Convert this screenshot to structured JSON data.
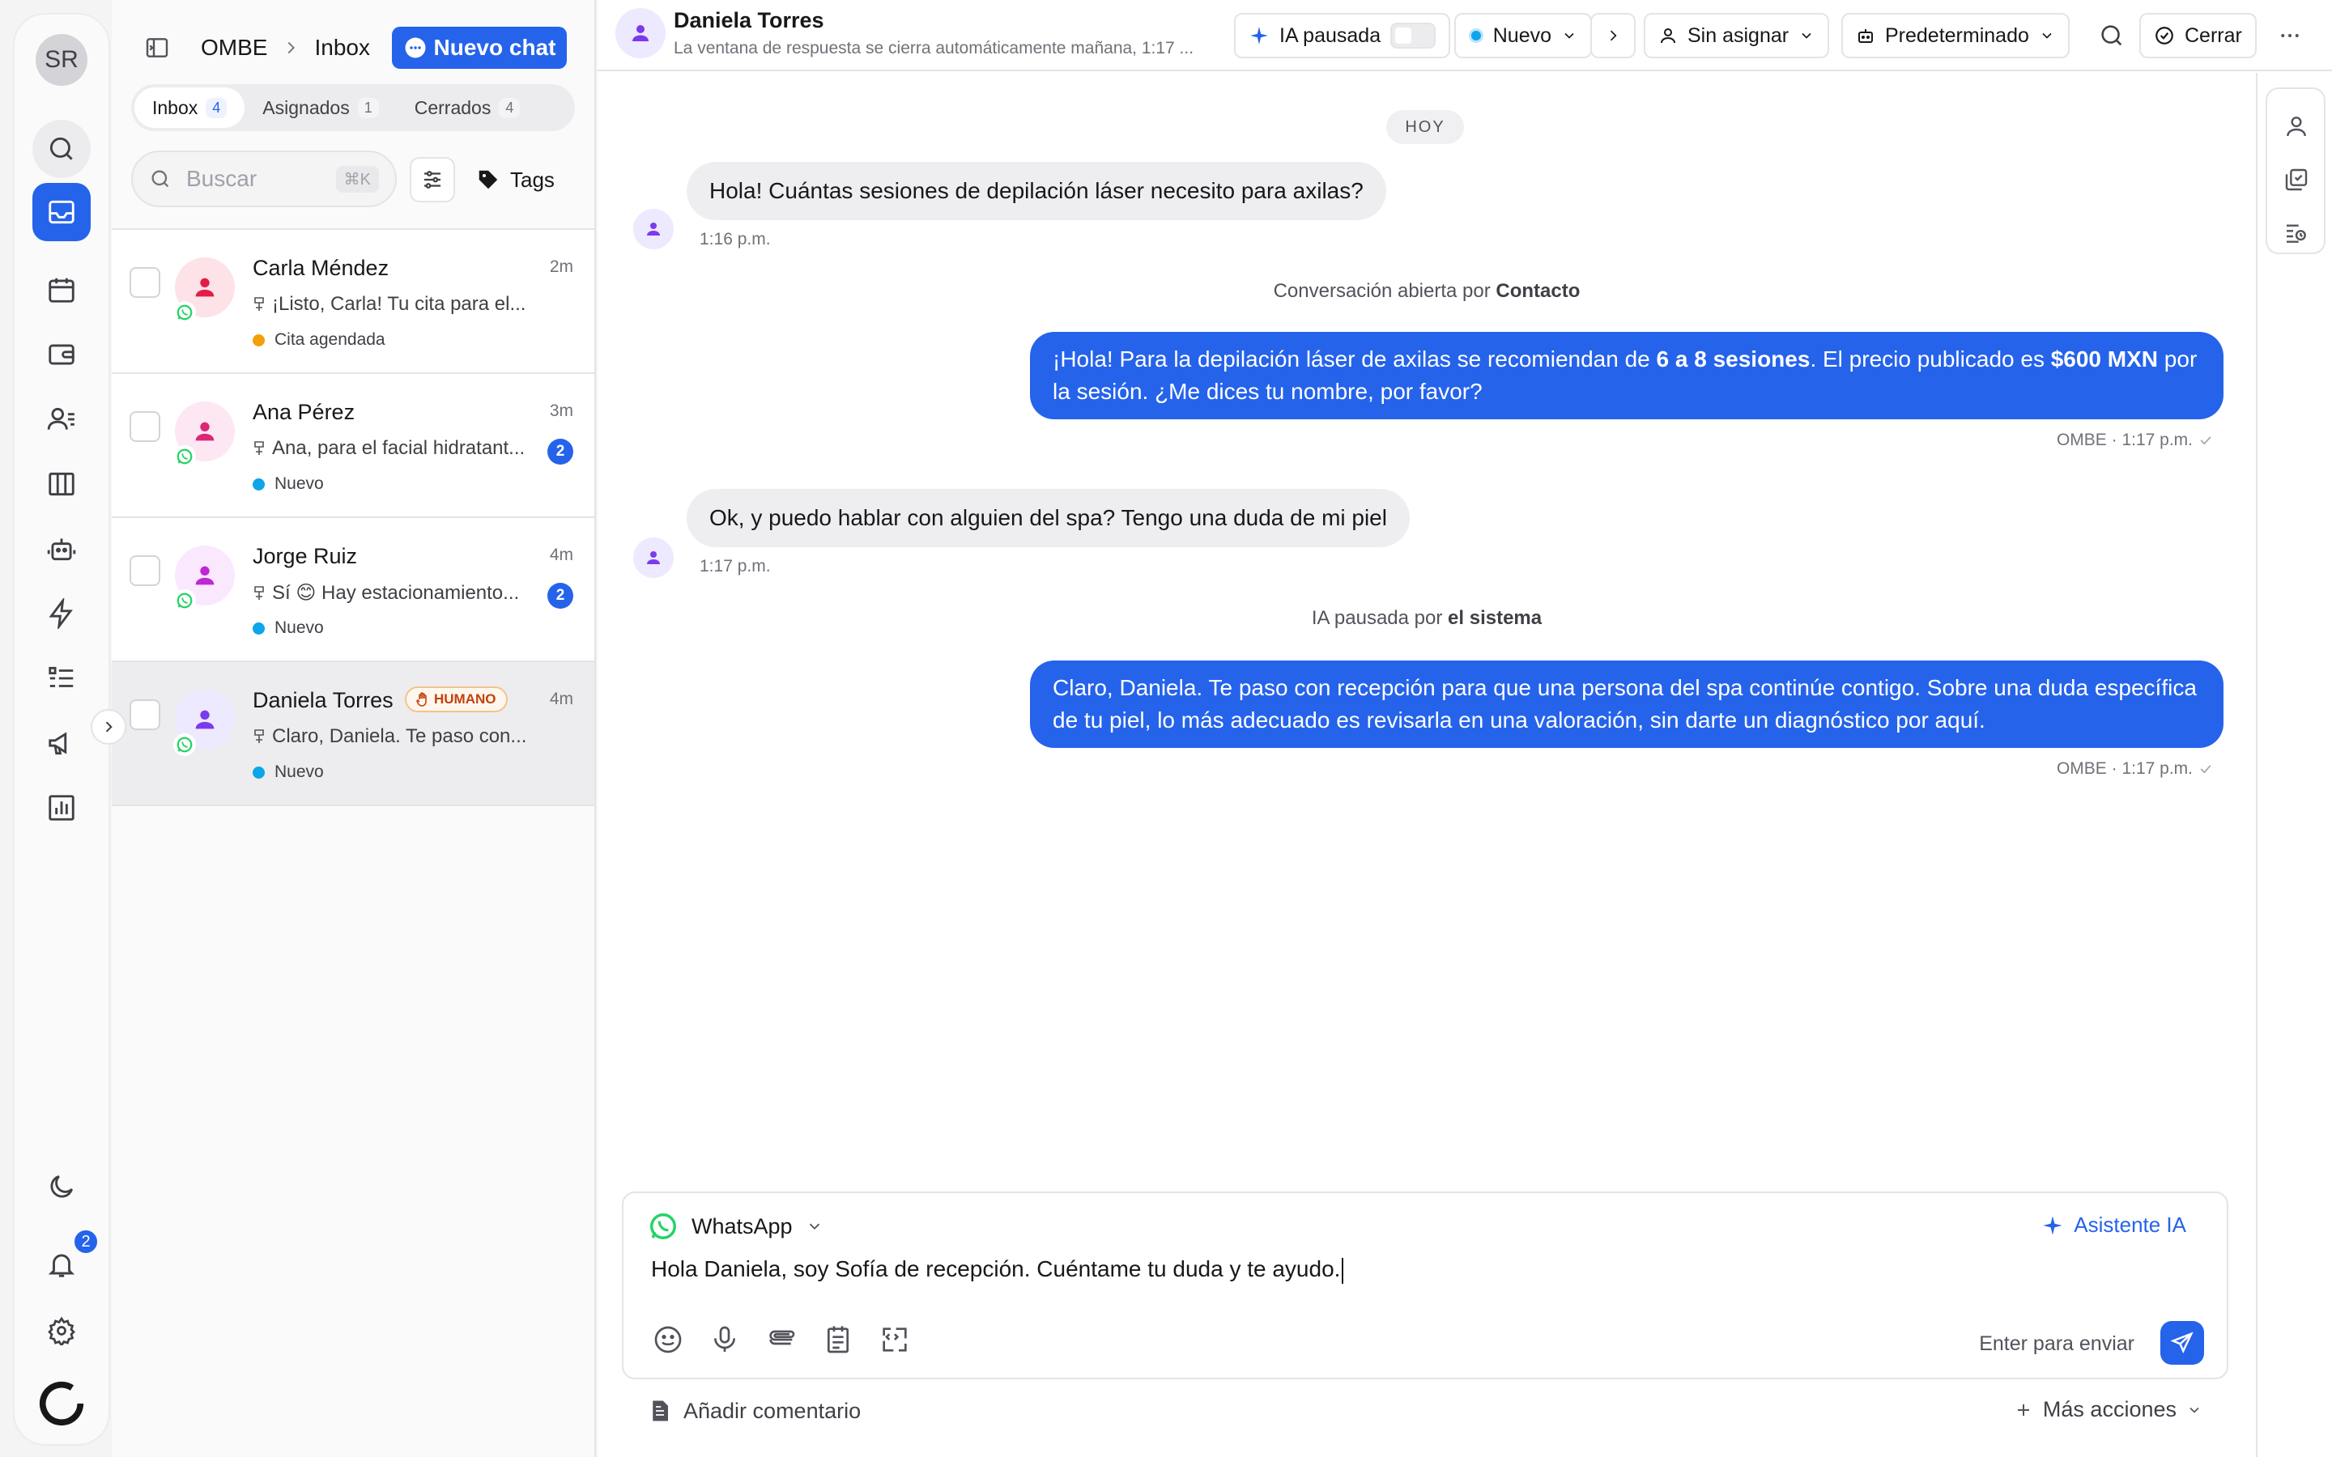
{
  "colors": {
    "accent": "#2563eb",
    "whatsapp": "#25d366",
    "status_new": "#0ea5e9",
    "status_scheduled": "#f59e0b",
    "human_badge": "#c2410c"
  },
  "rail": {
    "user_initials": "SR",
    "notification_count": "2",
    "icons": [
      "search-icon",
      "inbox-icon",
      "calendar-icon",
      "wallet-icon",
      "contacts-icon",
      "board-icon",
      "bot-icon",
      "bolt-icon",
      "list-icon",
      "megaphone-icon",
      "chart-icon",
      "moon-icon",
      "bell-icon",
      "gear-icon",
      "brand-logo-icon"
    ]
  },
  "list": {
    "breadcrumb_workspace": "OMBE",
    "breadcrumb_current": "Inbox",
    "new_chat_label": "Nuevo chat",
    "tabs": [
      {
        "label": "Inbox",
        "count": "4"
      },
      {
        "label": "Asignados",
        "count": "1"
      },
      {
        "label": "Cerrados",
        "count": "4"
      }
    ],
    "search_placeholder": "Buscar",
    "search_shortcut": "⌘K",
    "tags_label": "Tags",
    "conversations": [
      {
        "name": "Carla Méndez",
        "time": "2m",
        "preview": "¡Listo, Carla! Tu cita para el...",
        "status": "Cita agendada",
        "status_color": "#f59e0b",
        "avatar_bg": "#fde2e7",
        "avatar_fg": "#e11d48"
      },
      {
        "name": "Ana Pérez",
        "time": "3m",
        "preview": "Ana, para el facial hidratant...",
        "status": "Nuevo",
        "status_color": "#0ea5e9",
        "unread": "2",
        "avatar_bg": "#fce7f3",
        "avatar_fg": "#db2777"
      },
      {
        "name": "Jorge Ruiz",
        "time": "4m",
        "preview": "Sí 😊 Hay estacionamiento...",
        "status": "Nuevo",
        "status_color": "#0ea5e9",
        "unread": "2",
        "avatar_bg": "#fae8ff",
        "avatar_fg": "#c026d3"
      },
      {
        "name": "Daniela Torres",
        "time": "4m",
        "badge": "HUMANO",
        "preview": "Claro, Daniela. Te paso con...",
        "status": "Nuevo",
        "status_color": "#0ea5e9",
        "avatar_bg": "#ede9fe",
        "avatar_fg": "#7c3aed"
      }
    ]
  },
  "header": {
    "contact_name": "Daniela Torres",
    "subtitle": "La ventana de respuesta se cierra automáticamente mañana, 1:17 ...",
    "ai_label": "IA pausada",
    "status_label": "Nuevo",
    "assign_label": "Sin asignar",
    "inbox_label": "Predeterminado",
    "close_label": "Cerrar"
  },
  "thread": {
    "day_label": "HOY",
    "messages": [
      {
        "text": "Hola! Cuántas sesiones de depilación láser necesito para axilas?",
        "time": "1:16 p.m."
      },
      {
        "system_prefix": "Conversación abierta por ",
        "system_actor": "Contacto"
      },
      {
        "parts": [
          "¡Hola! Para la depilación láser de axilas se recomiendan de ",
          "6 a 8 sesiones",
          ". El precio publicado es ",
          "$600 MXN",
          " por la sesión. ¿Me dices tu nombre, por favor?"
        ],
        "meta": "OMBE · 1:17 p.m."
      },
      {
        "text": "Ok, y puedo hablar con alguien del spa? Tengo una duda de mi piel",
        "time": "1:17 p.m."
      },
      {
        "system_prefix": "IA pausada por ",
        "system_actor": "el sistema"
      },
      {
        "text": "Claro, Daniela. Te paso con recepción para que una persona del spa continúe contigo. Sobre una duda específica de tu piel, lo más adecuado es revisarla en una valoración, sin darte un diagnóstico por aquí.",
        "meta": "OMBE · 1:17 p.m."
      }
    ]
  },
  "composer": {
    "channel": "WhatsApp",
    "ai_assistant": "Asistente IA",
    "draft": "Hola Daniela, soy Sofía de recepción. Cuéntame tu duda y te ayudo.",
    "send_hint": "Enter para enviar",
    "add_comment": "Añadir comentario",
    "more_actions": "Más acciones"
  }
}
